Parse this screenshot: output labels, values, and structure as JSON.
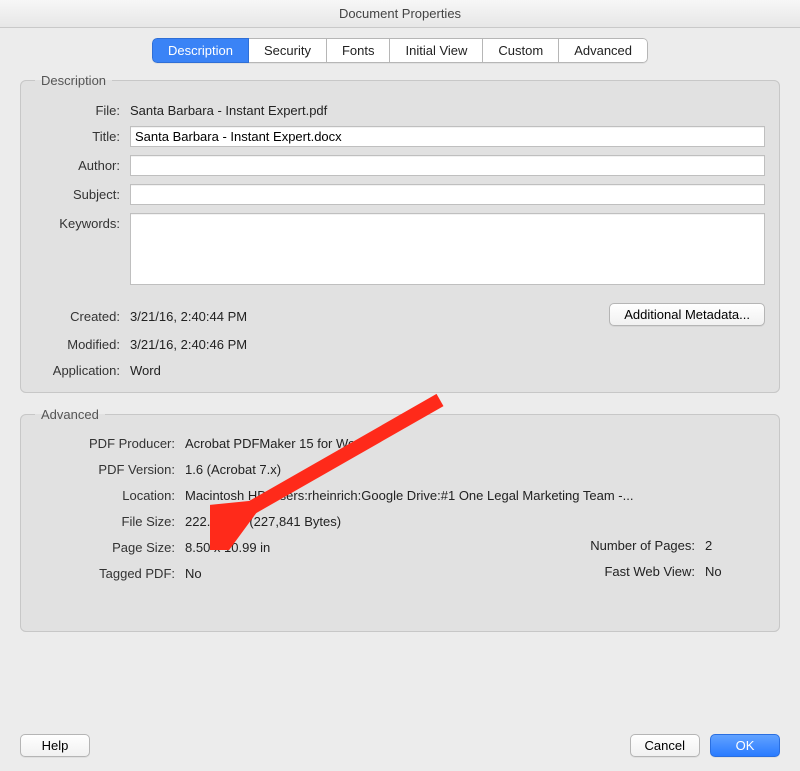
{
  "title": "Document Properties",
  "tabs": [
    {
      "label": "Description",
      "active": true
    },
    {
      "label": "Security",
      "active": false
    },
    {
      "label": "Fonts",
      "active": false
    },
    {
      "label": "Initial View",
      "active": false
    },
    {
      "label": "Custom",
      "active": false
    },
    {
      "label": "Advanced",
      "active": false
    }
  ],
  "description": {
    "legend": "Description",
    "labels": {
      "file": "File:",
      "title": "Title:",
      "author": "Author:",
      "subject": "Subject:",
      "keywords": "Keywords:",
      "created": "Created:",
      "modified": "Modified:",
      "application": "Application:"
    },
    "file_value": "Santa Barbara - Instant Expert.pdf",
    "title_value": "Santa Barbara - Instant Expert.docx",
    "author_value": "",
    "subject_value": "",
    "keywords_value": "",
    "created_value": "3/21/16, 2:40:44 PM",
    "modified_value": "3/21/16, 2:40:46 PM",
    "application_value": "Word",
    "metadata_button": "Additional Metadata..."
  },
  "advanced": {
    "legend": "Advanced",
    "labels": {
      "producer": "PDF Producer:",
      "version": "PDF Version:",
      "location": "Location:",
      "file_size": "File Size:",
      "page_size": "Page Size:",
      "tagged": "Tagged PDF:",
      "num_pages": "Number of Pages:",
      "fast_web": "Fast Web View:"
    },
    "producer_value": "Acrobat PDFMaker 15 for Word",
    "version_value": "1.6 (Acrobat 7.x)",
    "location_value": "Macintosh HD:Users:rheinrich:Google Drive:#1 One Legal Marketing Team -...",
    "file_size_value": "222.50 KB (227,841 Bytes)",
    "page_size_value": "8.50 x 10.99 in",
    "tagged_value": "No",
    "num_pages_value": "2",
    "fast_web_value": "No"
  },
  "footer": {
    "help": "Help",
    "cancel": "Cancel",
    "ok": "OK"
  }
}
